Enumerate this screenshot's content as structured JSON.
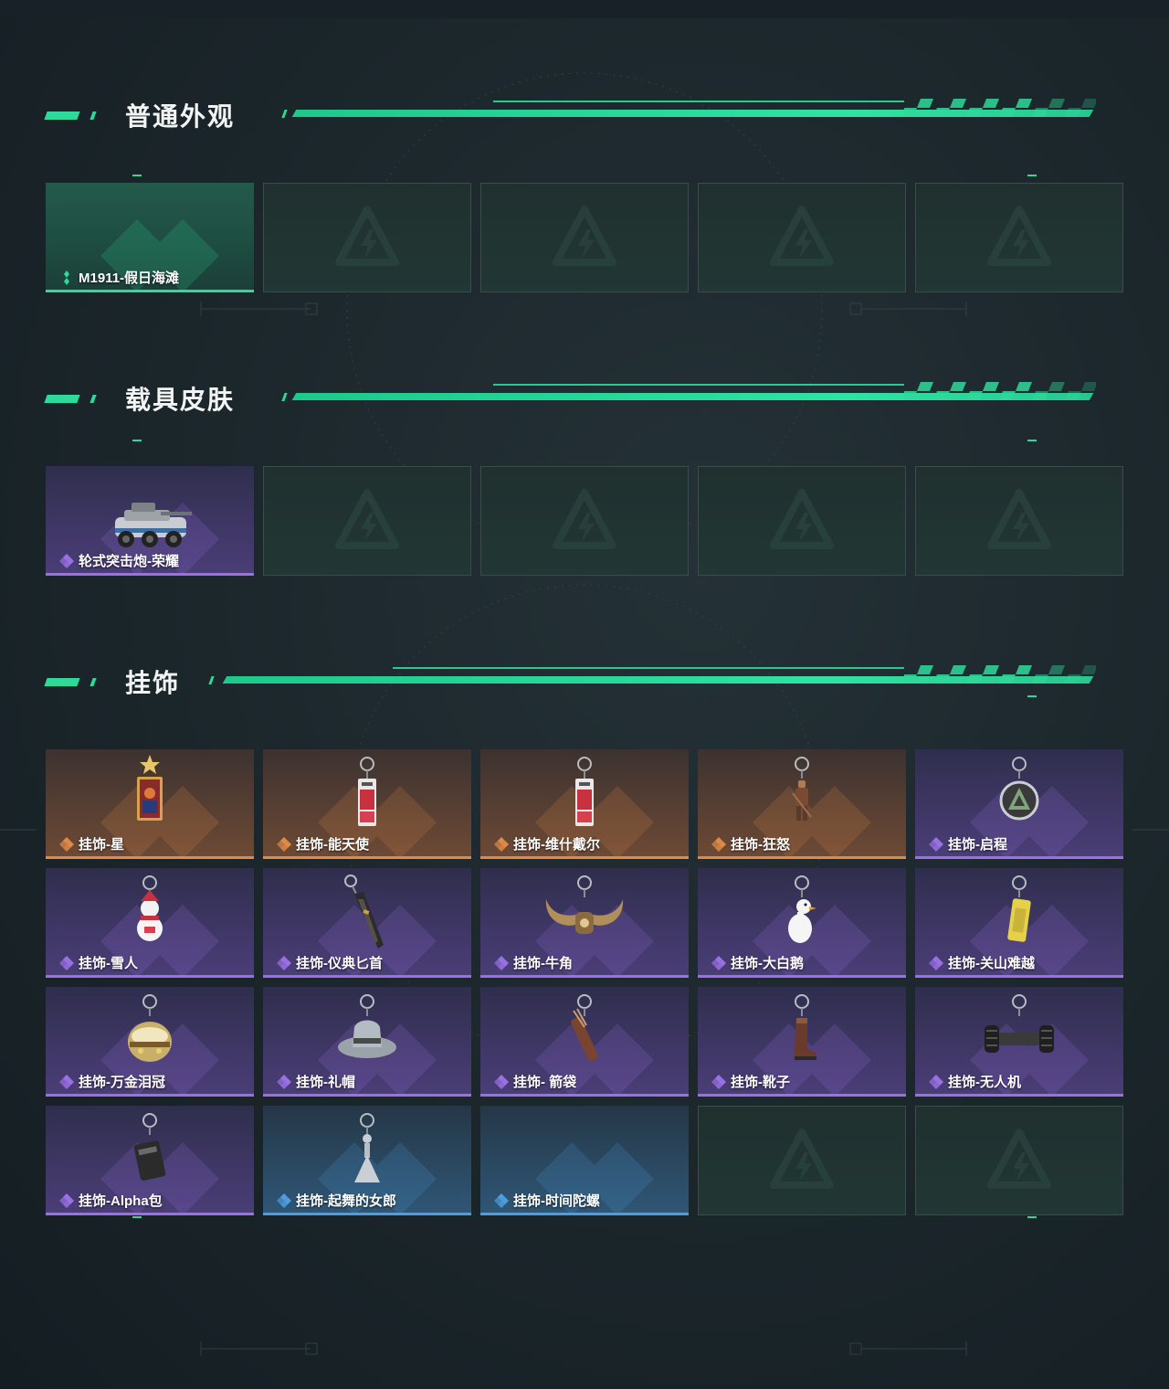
{
  "sections": [
    {
      "title": "普通外观",
      "cards": [
        {
          "label": "M1911-假日海滩",
          "rarity": "green",
          "icon": "rarity-green-icon",
          "art": "none"
        },
        {
          "label": "",
          "rarity": "empty",
          "art": "none"
        },
        {
          "label": "",
          "rarity": "empty",
          "art": "none"
        },
        {
          "label": "",
          "rarity": "empty",
          "art": "none"
        },
        {
          "label": "",
          "rarity": "empty",
          "art": "none"
        }
      ]
    },
    {
      "title": "载具皮肤",
      "cards": [
        {
          "label": "轮式突击炮-荣耀",
          "rarity": "purple",
          "icon": "rarity-purple-icon",
          "art": "armored-vehicle"
        },
        {
          "label": "",
          "rarity": "empty",
          "art": "none"
        },
        {
          "label": "",
          "rarity": "empty",
          "art": "none"
        },
        {
          "label": "",
          "rarity": "empty",
          "art": "none"
        },
        {
          "label": "",
          "rarity": "empty",
          "art": "none"
        }
      ]
    },
    {
      "title": "挂饰",
      "cards": [
        {
          "label": "挂饰-星",
          "rarity": "orange",
          "icon": "rarity-orange-icon",
          "art": "star-card-charm"
        },
        {
          "label": "挂饰-能天使",
          "rarity": "orange",
          "icon": "rarity-orange-icon",
          "art": "tag-charm"
        },
        {
          "label": "挂饰-维什戴尔",
          "rarity": "orange",
          "icon": "rarity-orange-icon",
          "art": "tag-charm"
        },
        {
          "label": "挂饰-狂怒",
          "rarity": "orange",
          "icon": "rarity-orange-icon",
          "art": "figure-charm"
        },
        {
          "label": "挂饰-启程",
          "rarity": "purple",
          "icon": "rarity-purple-icon",
          "art": "ring-charm"
        },
        {
          "label": "挂饰-雪人",
          "rarity": "purple",
          "icon": "rarity-purple-icon",
          "art": "snowman-charm"
        },
        {
          "label": "挂饰-仪典匕首",
          "rarity": "purple",
          "icon": "rarity-purple-icon",
          "art": "dagger-charm"
        },
        {
          "label": "挂饰-牛角",
          "rarity": "purple",
          "icon": "rarity-purple-icon",
          "art": "horns-charm"
        },
        {
          "label": "挂饰-大白鹅",
          "rarity": "purple",
          "icon": "rarity-purple-icon",
          "art": "goose-charm"
        },
        {
          "label": "挂饰-关山难越",
          "rarity": "purple",
          "icon": "rarity-purple-icon",
          "art": "bar-charm"
        },
        {
          "label": "挂饰-万金泪冠",
          "rarity": "purple",
          "icon": "rarity-purple-icon",
          "art": "crown-charm"
        },
        {
          "label": "挂饰-礼帽",
          "rarity": "purple",
          "icon": "rarity-purple-icon",
          "art": "hat-charm"
        },
        {
          "label": "挂饰- 箭袋",
          "rarity": "purple",
          "icon": "rarity-purple-icon",
          "art": "quiver-charm"
        },
        {
          "label": "挂饰-靴子",
          "rarity": "purple",
          "icon": "rarity-purple-icon",
          "art": "boot-charm"
        },
        {
          "label": "挂饰-无人机",
          "rarity": "purple",
          "icon": "rarity-purple-icon",
          "art": "drone-charm"
        },
        {
          "label": "挂饰-Alpha包",
          "rarity": "purple",
          "icon": "rarity-purple-icon",
          "art": "bag-charm"
        },
        {
          "label": "挂饰-起舞的女郎",
          "rarity": "blue",
          "icon": "rarity-blue-icon",
          "art": "dancer-charm"
        },
        {
          "label": "挂饰-时间陀螺",
          "rarity": "blue",
          "icon": "rarity-blue-icon",
          "art": "none"
        },
        {
          "label": "",
          "rarity": "empty",
          "art": "none"
        },
        {
          "label": "",
          "rarity": "empty",
          "art": "none"
        }
      ]
    }
  ],
  "colors": {
    "accent": "#2fd99a",
    "purple": "#9a71e4",
    "orange": "#e08a47",
    "blue": "#4d9de0",
    "green": "#2fd99a"
  }
}
